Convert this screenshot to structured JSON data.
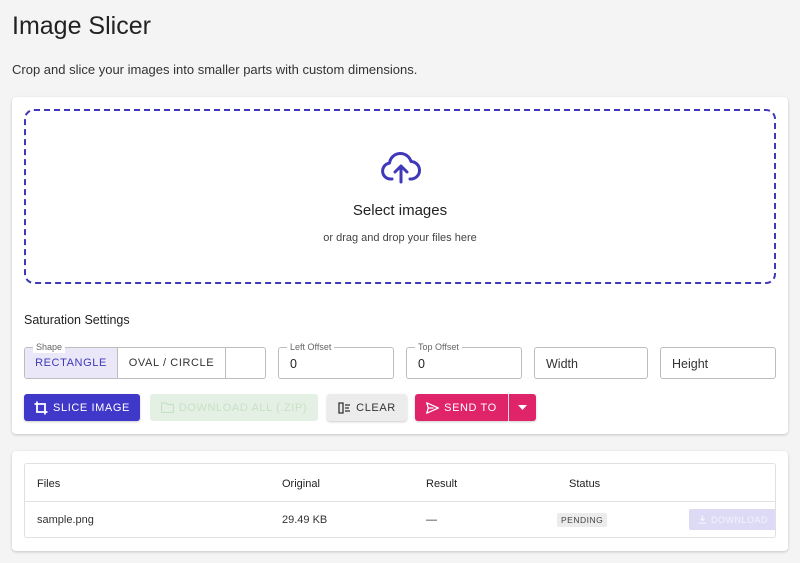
{
  "header": {
    "title": "Image Slicer",
    "subtitle": "Crop and slice your images into smaller parts with custom dimensions."
  },
  "dropzone": {
    "title": "Select images",
    "subtitle": "or drag and drop your files here",
    "icon": "cloud-upload-icon"
  },
  "settings": {
    "label": "Saturation Settings",
    "shape": {
      "legend": "Shape",
      "options": [
        "RECTANGLE",
        "OVAL / CIRCLE"
      ],
      "selected": "RECTANGLE"
    },
    "left_offset": {
      "legend": "Left Offset",
      "value": "0"
    },
    "top_offset": {
      "legend": "Top Offset",
      "value": "0"
    },
    "width": {
      "placeholder": "Width"
    },
    "height": {
      "placeholder": "Height"
    }
  },
  "actions": {
    "slice": "SLICE IMAGE",
    "download_all": "DOWNLOAD ALL (.ZIP)",
    "clear": "CLEAR",
    "send_to": "SEND TO"
  },
  "table": {
    "columns": [
      "Files",
      "Original",
      "Result",
      "Status"
    ],
    "rows": [
      {
        "file": "sample.png",
        "original": "29.49 KB",
        "result": "—",
        "status": "PENDING",
        "action": "DOWNLOAD"
      }
    ]
  },
  "colors": {
    "accent": "#3f38c9",
    "send": "#e0246a",
    "background": "#f4f4f4"
  }
}
